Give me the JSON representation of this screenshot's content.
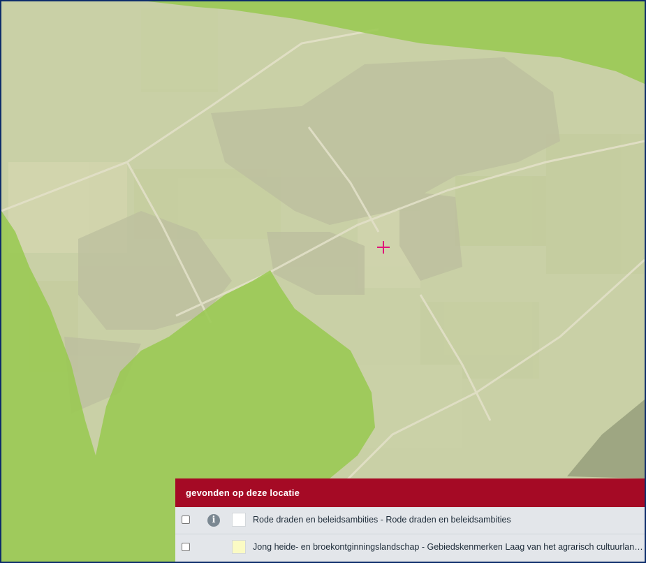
{
  "map": {
    "layers": [
      {
        "name": "background-aerial",
        "color": "#c9d0a6"
      },
      {
        "name": "green-zone",
        "color": "#98c94f"
      }
    ],
    "marker_color": "#e0147a",
    "icons": [
      "crosshair-icon",
      "info-icon"
    ]
  },
  "panel": {
    "title": "gevonden op deze locatie",
    "header_color": "#a50a25",
    "rows": [
      {
        "label": "Rode draden en beleidsambities - Rode draden en beleidsambities",
        "swatch_color": "#ffffff",
        "has_info": true,
        "checked": false
      },
      {
        "label": "Jong heide- en broekontginningslandschap - Gebiedskenmerken Laag van het agrarisch cultuurlandschap",
        "swatch_color": "#fbfbc4",
        "has_info": false,
        "checked": false
      }
    ]
  }
}
